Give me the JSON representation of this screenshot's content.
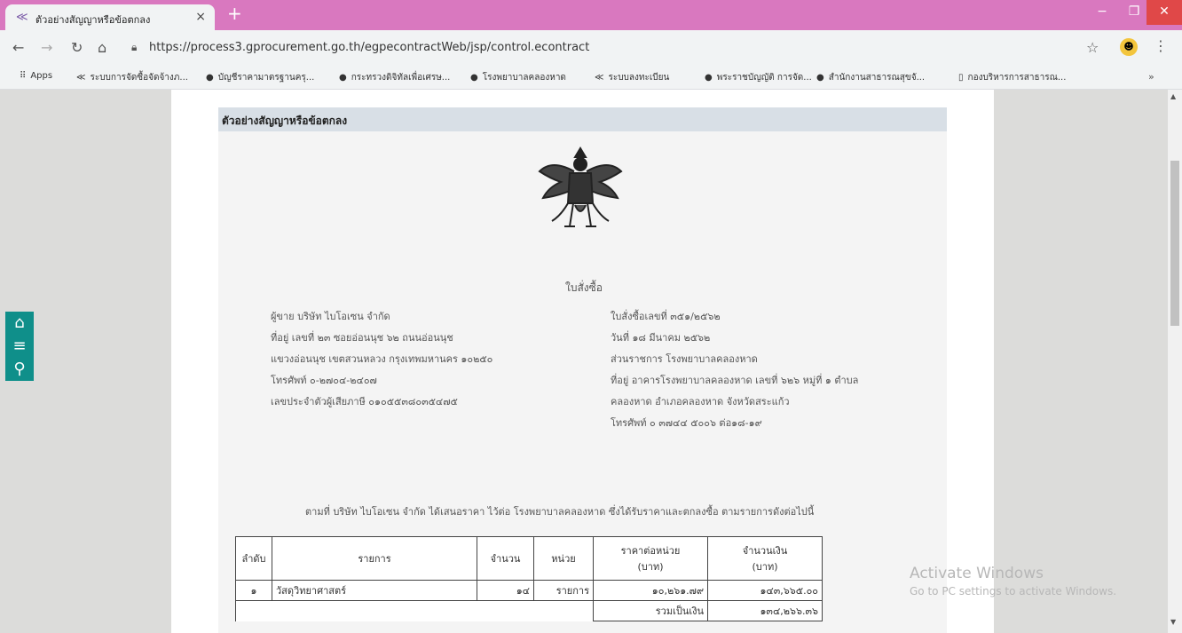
{
  "browser": {
    "tab_title": "ตัวอย่างสัญญาหรือข้อตกลง",
    "tab_close": "×",
    "new_tab": "+",
    "url": "https://process3.gprocurement.go.th/egpecontractWeb/jsp/control.econtract",
    "window_min": "−",
    "window_max": "❐",
    "window_close": "✕"
  },
  "bookmarks": [
    {
      "label": "Apps",
      "icon": "apps-icon",
      "glyph": "⠿"
    },
    {
      "label": "ระบบการจัดซื้อจัดจ้างภ...",
      "icon": "egp-icon",
      "glyph": "≪"
    },
    {
      "label": "บัญชีราคามาตรฐานครุ...",
      "icon": "globe-icon",
      "glyph": "●"
    },
    {
      "label": "กระทรวงดิจิทัลเพื่อเศรษ...",
      "icon": "ministry-icon",
      "glyph": "●"
    },
    {
      "label": "โรงพยาบาลคลองหาด",
      "icon": "hospital-icon",
      "glyph": "●"
    },
    {
      "label": "ระบบลงทะเบียน",
      "icon": "register-icon",
      "glyph": "≪"
    },
    {
      "label": "พระราชบัญญัติ การจัด...",
      "icon": "law-icon",
      "glyph": "●"
    },
    {
      "label": "สำนักงานสาธารณสุขจั...",
      "icon": "health-office-icon",
      "glyph": "●"
    },
    {
      "label": "กองบริหารการสาธารณ...",
      "icon": "page-icon",
      "glyph": "▯"
    }
  ],
  "bookmarks_more": "»",
  "panel": {
    "header": "ตัวอย่างสัญญาหรือข้อตกลง",
    "doc_title": "ใบสั่งซื้อ"
  },
  "seller": {
    "name": "ผู้ขาย  บริษัท ไบโอเซน จำกัด",
    "address1": "ที่อยู่  เลขที่ ๒๓ ซอยอ่อนนุช ๖๒ ถนนอ่อนนุช",
    "address2": "แขวงอ่อนนุช เขตสวนหลวง กรุงเทพมหานคร ๑๐๒๕๐",
    "phone": "โทรศัพท์  ๐-๒๗๐๔-๒๔๐๗",
    "tax_id": "เลขประจำตัวผู้เสียภาษี  ๐๑๐๕๕๓๘๐๓๕๔๗๕"
  },
  "buyer": {
    "po_number": "ใบสั่งซื้อเลขที่  ๓๕๑/๒๕๖๒",
    "date": "วันที่  ๑๘ มีนาคม ๒๕๖๒",
    "agency": "ส่วนราชการ  โรงพยาบาลคลองหาด",
    "address1": "ที่อยู่  อาคารโรงพยาบาลคลองหาด เลขที่ ๖๒๖ หมู่ที่ ๑ ตำบล",
    "address2": "คลองหาด อำเภอคลองหาด จังหวัดสระแก้ว",
    "phone": "โทรศัพท์  ๐ ๓๗๔๔ ๕๐๐๖ ต่อ๑๘-๑๙"
  },
  "paragraph": "ตามที่ บริษัท ไบโอเซน จำกัด ได้เสนอราคา ไว้ต่อ โรงพยาบาลคลองหาด ซึ่งได้รับราคาและตกลงซื้อ ตามรายการดังต่อไปนี้",
  "table": {
    "headers": [
      "ลำดับ",
      "รายการ",
      "จำนวน",
      "หน่วย",
      "ราคาต่อหน่วย\n(บาท)",
      "จำนวนเงิน\n(บาท)"
    ],
    "rows": [
      [
        "๑",
        "วัสดุวิทยาศาสตร์",
        "๑๔",
        "รายการ",
        "๑๐,๒๖๑.๗๙",
        "๑๔๓,๖๖๕.๐๐"
      ]
    ],
    "total_label": "รวมเป็นเงิน",
    "total_value": "๑๓๔,๒๖๖.๓๖"
  },
  "watermark": {
    "line1": "Activate Windows",
    "line2": "Go to PC settings to activate Windows."
  },
  "colors": {
    "titlebar": "#d978bf",
    "side_buttons": "#0f8f8a",
    "panel_header": "#d8dfe6"
  }
}
